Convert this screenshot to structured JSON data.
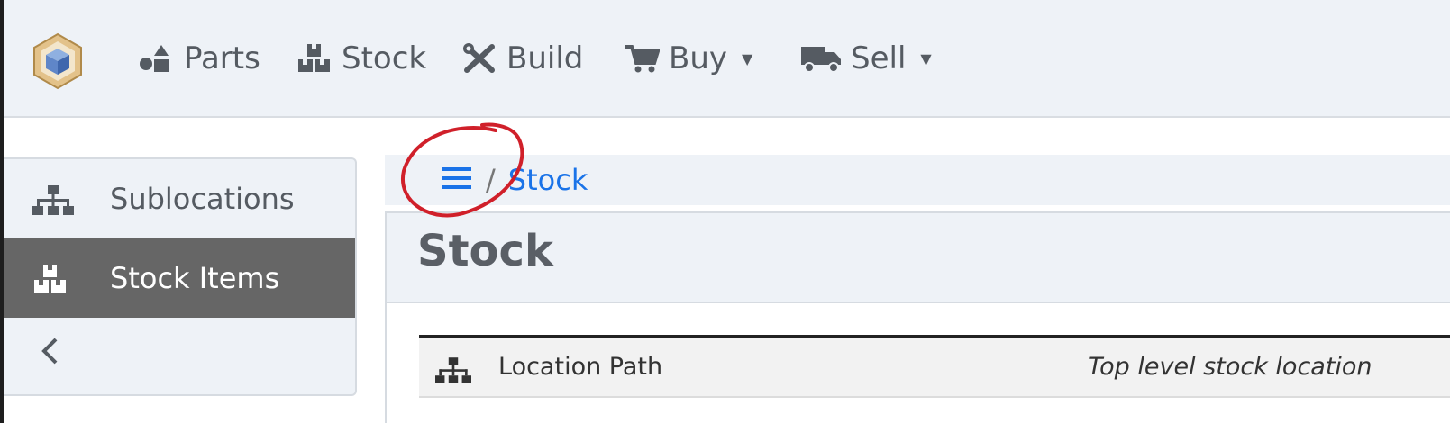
{
  "navbar": {
    "items": [
      {
        "label": "Parts",
        "icon": "shapes-icon"
      },
      {
        "label": "Stock",
        "icon": "boxes-icon"
      },
      {
        "label": "Build",
        "icon": "tools-icon"
      },
      {
        "label": "Buy",
        "icon": "cart-icon",
        "dropdown": true
      },
      {
        "label": "Sell",
        "icon": "truck-icon",
        "dropdown": true
      }
    ]
  },
  "sidebar": {
    "items": [
      {
        "label": "Sublocations",
        "icon": "sitemap-icon"
      },
      {
        "label": "Stock Items",
        "icon": "boxes-icon",
        "active": true
      }
    ],
    "collapse_icon": "chevron-left-icon"
  },
  "breadcrumb": {
    "menu_icon": "bars-icon",
    "separator": "/",
    "items": [
      {
        "label": "Stock"
      }
    ]
  },
  "page": {
    "title": "Stock"
  },
  "details": {
    "rows": [
      {
        "label": "Location Path",
        "value": "Top level stock location",
        "icon": "sitemap-icon"
      }
    ]
  },
  "colors": {
    "navbar_bg": "#eef2f7",
    "link": "#1a73e8",
    "active_item_bg": "#666666",
    "annotation": "#d0202a"
  }
}
